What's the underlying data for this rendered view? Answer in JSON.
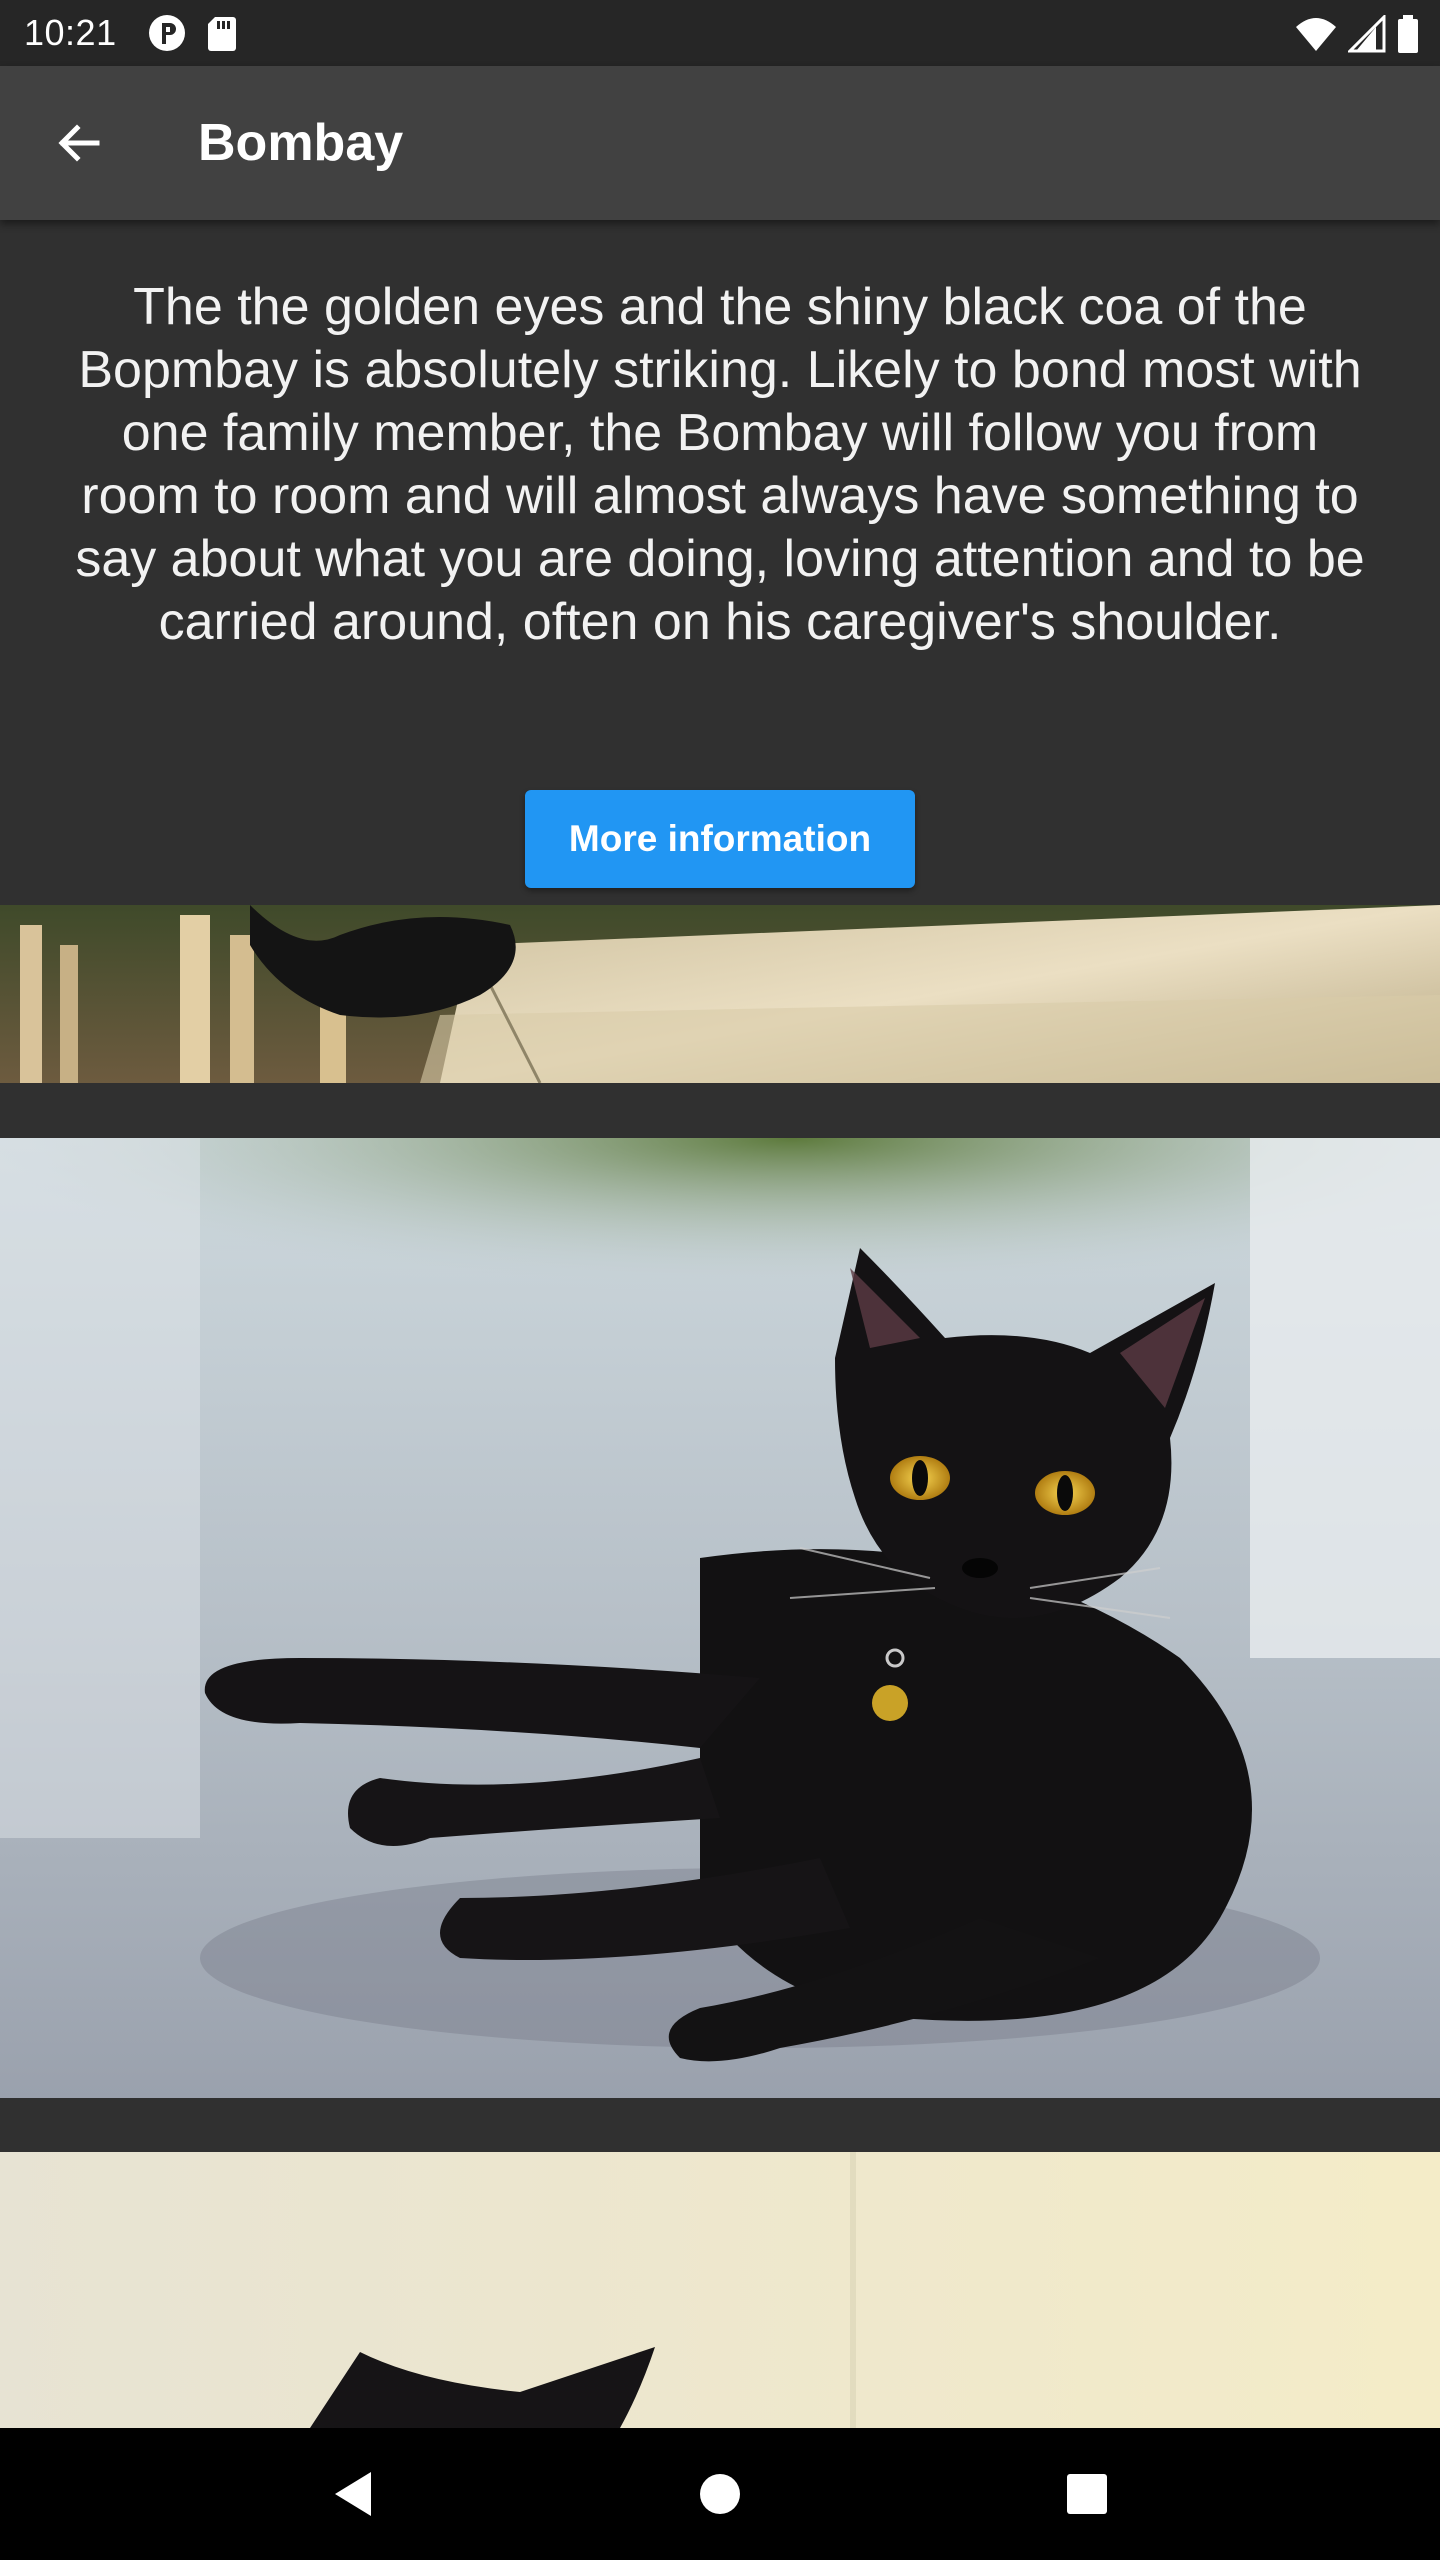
{
  "status_bar": {
    "time": "10:21",
    "left_icons": [
      "p-icon",
      "sd-card-icon"
    ],
    "right_icons": [
      "wifi-icon",
      "signal-icon",
      "battery-icon"
    ]
  },
  "app_bar": {
    "title": "Bombay",
    "back_icon": "arrow-back-icon"
  },
  "content": {
    "description": "The the golden eyes and the shiny black coa of the Bopmbay is absolutely striking. Likely to bond most with one family member, the Bombay will follow you from room to room and will almost always have something to say about what you are doing, loving attention and to be carried around, often on his caregiver's shoulder.",
    "more_button_label": "More information",
    "accent_color": "#2196f3",
    "photos": [
      {
        "subject": "black cat paw on stone ledge"
      },
      {
        "subject": "black Bombay cat lying on floor"
      },
      {
        "subject": "black cat ears against cream wall"
      }
    ]
  },
  "nav_bar": {
    "buttons": [
      "back-triangle-icon",
      "home-circle-icon",
      "recents-square-icon"
    ]
  }
}
